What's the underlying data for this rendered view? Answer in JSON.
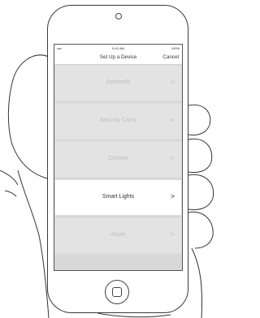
{
  "status_bar": {
    "carrier": "•••••",
    "time": "9:41 AM",
    "battery": "100%"
  },
  "nav": {
    "title": "Set Up a Device",
    "cancel_label": "Cancel"
  },
  "devices": [
    {
      "label": "Doorbells",
      "active": false
    },
    {
      "label": "Security Cams",
      "active": false
    },
    {
      "label": "Chimes",
      "active": false
    },
    {
      "label": "Smart Lights",
      "active": true
    },
    {
      "label": "Alarm",
      "active": false
    }
  ],
  "chevron_icon": "chevron-right-icon",
  "colors": {
    "screen_bg": "#d8d8d8",
    "active_row": "#ffffff",
    "inactive_text": "#bdbdbd",
    "active_text": "#333333"
  }
}
